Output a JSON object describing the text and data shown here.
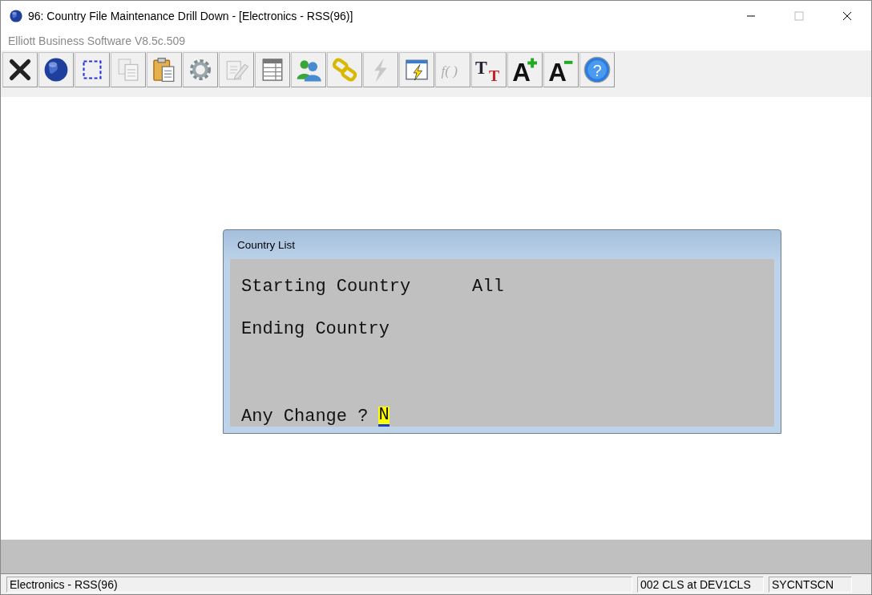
{
  "window": {
    "title": "96: Country File Maintenance Drill Down - [Electronics - RSS(96)]",
    "subtitle": "Elliott Business Software V8.5c.509"
  },
  "toolbar": [
    {
      "kind": "close",
      "disabled": false
    },
    {
      "kind": "globe",
      "disabled": false
    },
    {
      "kind": "select",
      "disabled": false
    },
    {
      "kind": "copy",
      "disabled": true
    },
    {
      "kind": "paste",
      "disabled": false
    },
    {
      "kind": "gear",
      "disabled": false
    },
    {
      "kind": "edit",
      "disabled": true
    },
    {
      "kind": "table",
      "disabled": false
    },
    {
      "kind": "users",
      "disabled": false
    },
    {
      "kind": "link",
      "disabled": false
    },
    {
      "kind": "bolt",
      "disabled": true
    },
    {
      "kind": "winbolt",
      "disabled": false
    },
    {
      "kind": "fx",
      "disabled": true,
      "glyphs": [
        "f( )"
      ]
    },
    {
      "kind": "font",
      "disabled": false,
      "glyphs": [
        "T",
        "T"
      ]
    },
    {
      "kind": "bigger",
      "disabled": false,
      "glyphs": [
        "A"
      ]
    },
    {
      "kind": "smaller",
      "disabled": false,
      "glyphs": [
        "A"
      ]
    },
    {
      "kind": "help",
      "disabled": false,
      "glyphs": [
        "?"
      ]
    }
  ],
  "dialog": {
    "title": "Country List",
    "fields": [
      {
        "label": "Starting Country",
        "value": "All"
      },
      {
        "label": "Ending Country"
      }
    ],
    "prompt": {
      "label": "Any Change ?",
      "value": "N"
    }
  },
  "status_bar": [
    "Electronics - RSS(96)",
    "002 CLS at DEV1CLS",
    "SYCNTSCN"
  ]
}
